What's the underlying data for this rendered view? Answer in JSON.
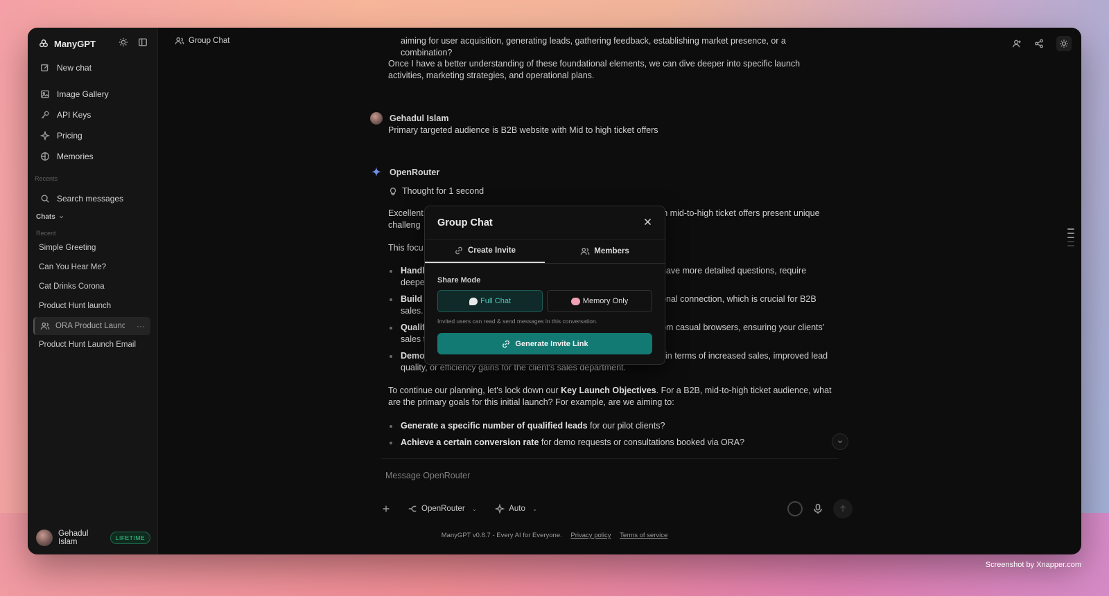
{
  "app": {
    "name": "ManyGPT",
    "header_title": "Group Chat"
  },
  "sidebar": {
    "new_chat": "New chat",
    "nav": [
      {
        "label": "Image Gallery",
        "icon": "image-icon"
      },
      {
        "label": "API Keys",
        "icon": "key-icon"
      },
      {
        "label": "Pricing",
        "icon": "sparkle-icon"
      },
      {
        "label": "Memories",
        "icon": "memory-icon"
      }
    ],
    "recents_label": "Recents",
    "search_label": "Search messages",
    "chats_label": "Chats",
    "recent_label": "Recent",
    "chats": [
      {
        "label": "Simple Greeting"
      },
      {
        "label": "Can You Hear Me?"
      },
      {
        "label": "Cat Drinks Corona"
      },
      {
        "label": "Product Hunt launch"
      },
      {
        "label": "ORA Product Launch"
      },
      {
        "label": "Product Hunt Launch Email"
      }
    ],
    "user_name": "Gehadul Islam",
    "plan_badge": "LIFETIME"
  },
  "conversation": {
    "top_partial_line": "aiming for user acquisition, generating leads, gathering feedback, establishing market presence, or a combination?",
    "top_para": "Once I have a better understanding of these foundational elements, we can dive deeper into specific launch activities, marketing strategies, and operational plans.",
    "user_name": "Gehadul Islam",
    "user_msg": "Primary targeted audience is B2B website with Mid to high ticket offers",
    "bot_name": "OpenRouter",
    "thought": "Thought for 1 second",
    "p1a": "Excellent,",
    "p1b": "ith mid-to-high ticket offers present unique",
    "p1c": "challeng",
    "p2": "This focu",
    "b1a": "Handl",
    "b1b": "have more detailed questions, require",
    "b1c": "deepe",
    "b2a": "Build",
    "b2b": "onal connection, which is crucial for B2B",
    "b2c": "sales.",
    "b3a": "Qualif",
    "b3b": "om casual browsers, ensuring your clients'",
    "b3c": "sales t",
    "b4a": "Demo",
    "b4b": "in terms of increased sales, improved lead",
    "b4c": "quality, or efficiency gains for the client's sales department.",
    "p3_pre": "To continue our planning, let's lock down our ",
    "p3_bold": "Key Launch Objectives",
    "p3_post": ". For a B2B, mid-to-high ticket audience, what are the primary goals for this initial launch? For example, are we aiming to:",
    "li1_bold": "Generate a specific number of qualified leads",
    "li1_rest": " for our pilot clients?",
    "li2_bold": "Achieve a certain conversion rate",
    "li2_rest": " for demo requests or consultations booked via ORA?"
  },
  "composer": {
    "placeholder": "Message OpenRouter",
    "model": "OpenRouter",
    "mode": "Auto"
  },
  "footer": {
    "text": "ManyGPT v0.8.7 - Every AI for Everyone.",
    "privacy": "Privacy policy",
    "terms": "Terms of service"
  },
  "modal": {
    "title": "Group Chat",
    "tabs": [
      "Create Invite",
      "Members"
    ],
    "share_mode_label": "Share Mode",
    "mode_full": "Full Chat",
    "mode_memory": "Memory Only",
    "description": "Invited users can read & send messages in this conversation.",
    "generate_label": "Generate Invite Link"
  },
  "credit": "Screenshot by Xnapper.com",
  "colors": {
    "accent": "#137a73",
    "badge_green": "#3fcf8e",
    "window_bg": "#0d0d0d"
  }
}
